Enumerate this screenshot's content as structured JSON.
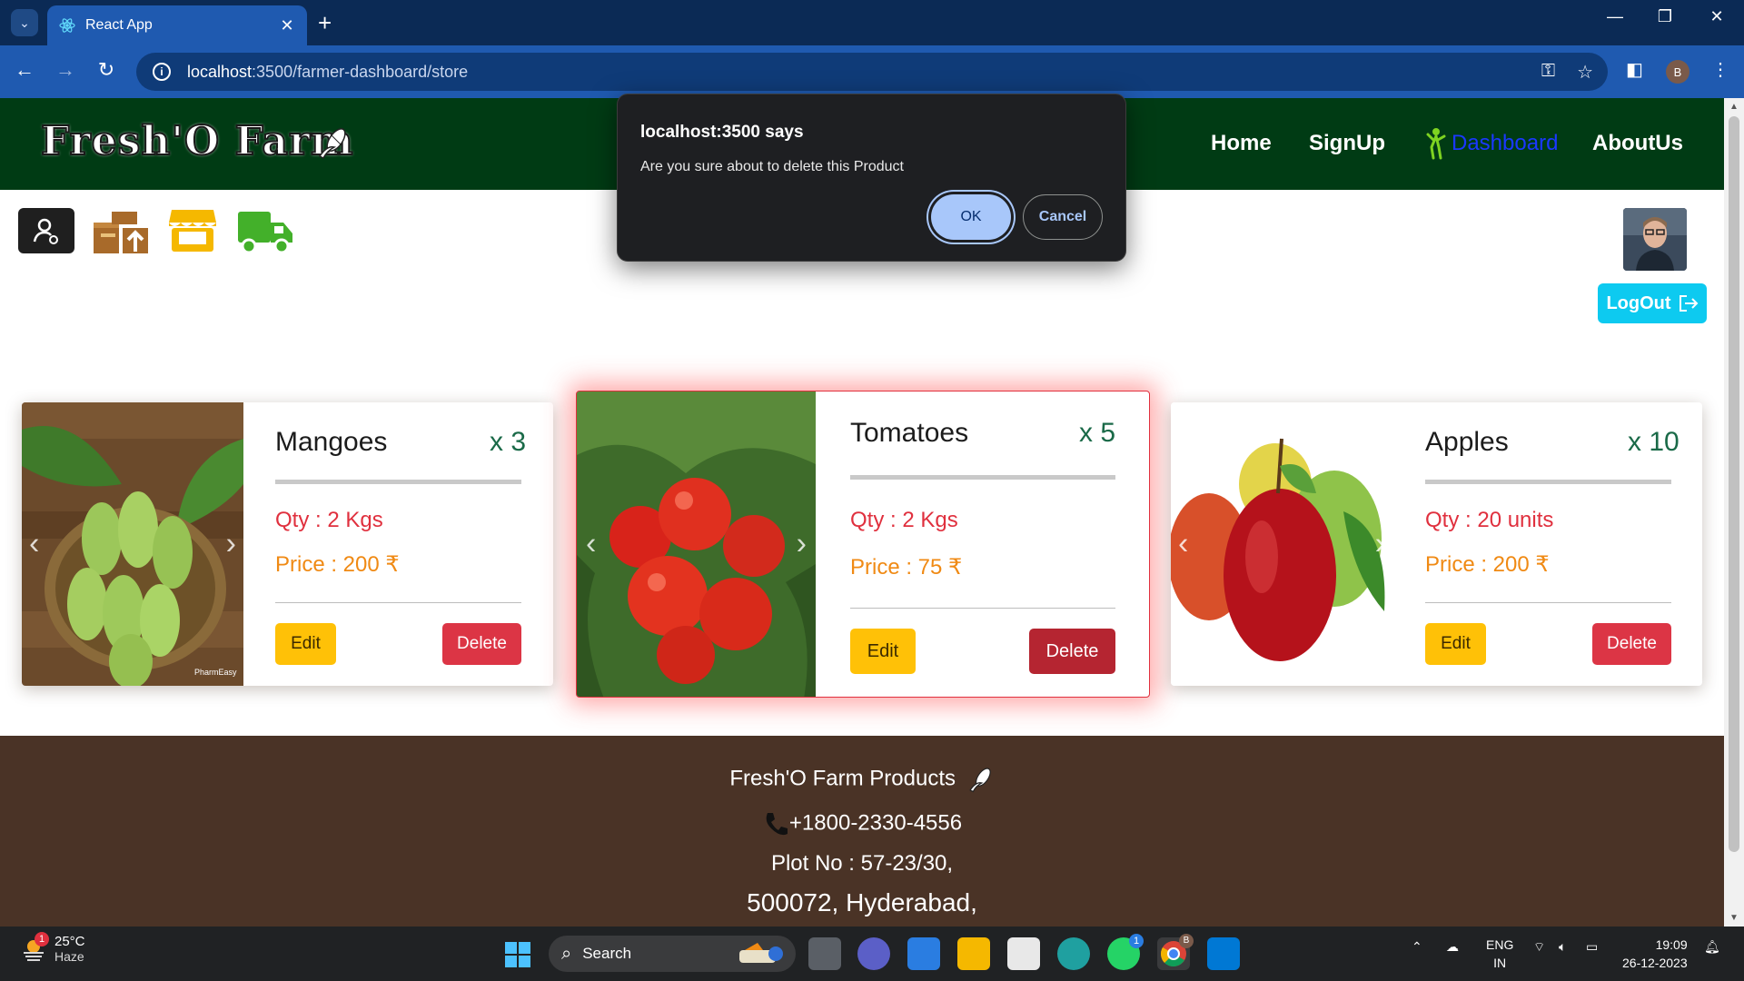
{
  "browser": {
    "tab_title": "React App",
    "url_host": "localhost",
    "url_path": ":3500/farmer-dashboard/store"
  },
  "header": {
    "logo_text": "Fresh'O Farm",
    "nav": {
      "home": "Home",
      "signup": "SignUp",
      "dashboard": "Dashboard",
      "aboutus": "AboutUs"
    }
  },
  "toolbar": {
    "logout_label": "LogOut"
  },
  "products": [
    {
      "name": "Mangoes",
      "count": "x 3",
      "qty": "Qty : 2 Kgs",
      "price": "Price : 200 ₹",
      "edit": "Edit",
      "delete": "Delete"
    },
    {
      "name": "Tomatoes",
      "count": "x 5",
      "qty": "Qty : 2 Kgs",
      "price": "Price : 75 ₹",
      "edit": "Edit",
      "delete": "Delete"
    },
    {
      "name": "Apples",
      "count": "x 10",
      "qty": "Qty : 20 units",
      "price": "Price : 200 ₹",
      "edit": "Edit",
      "delete": "Delete"
    }
  ],
  "mango_watermark": "PharmEasy",
  "footer": {
    "brand": "Fresh'O Farm Products",
    "phone": "+1800-2330-4556",
    "address_line1": "Plot No : 57-23/30,",
    "address_line2": "500072, Hyderabad,"
  },
  "dialog": {
    "title": "localhost:3500 says",
    "message": "Are you sure about to delete this Product",
    "ok_label": "OK",
    "cancel_label": "Cancel"
  },
  "taskbar": {
    "weather_temp": "25°C",
    "weather_cond": "Haze",
    "weather_badge": "1",
    "search_label": "Search",
    "whatsapp_badge": "1",
    "chrome_badge": "B",
    "lang_line1": "ENG",
    "lang_line2": "IN",
    "time": "19:09",
    "date": "26-12-2023"
  },
  "profile_initial": "B",
  "colors": {
    "header_bg": "#003b14",
    "footer_bg": "#4a3326",
    "logout_bg": "#0dcaf0",
    "edit_bg": "#ffc107",
    "delete_bg": "#dc3545",
    "qty_color": "#e0303e",
    "price_color": "#f08a14"
  }
}
